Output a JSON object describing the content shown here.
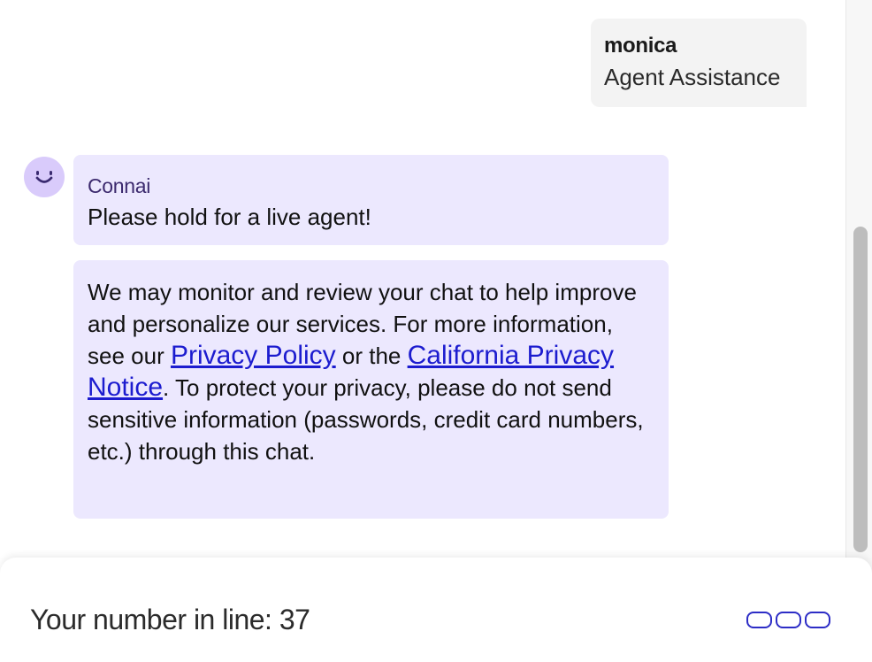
{
  "conversation": {
    "user_message": {
      "sender": "monica",
      "text": "Agent Assistance"
    },
    "bot_messages": [
      {
        "sender": "Connai",
        "text": "Please hold for a live agent!"
      },
      {
        "notice_part1": "We may monitor and review your chat to help improve and personalize our services. For more information, see our ",
        "privacy_policy_link": "Privacy Policy",
        "notice_part2": " or the ",
        "california_notice_link": "California Privacy Notice",
        "notice_part3": ". To protect your privacy, please do not send sensitive information (passwords, credit card numbers, etc.) through this chat."
      }
    ],
    "avatar_icon": "smiley-face-icon"
  },
  "footer": {
    "queue_text": "Your number in line: 37",
    "typing_indicator_icon": "typing-dots-icon"
  },
  "colors": {
    "bot_bubble_bg": "#ece8fe",
    "user_bubble_bg": "#f3f3f3",
    "avatar_bg": "#d9cbfb",
    "link_color": "#1c1ccf",
    "typing_dots_color": "#2d2dc6"
  }
}
